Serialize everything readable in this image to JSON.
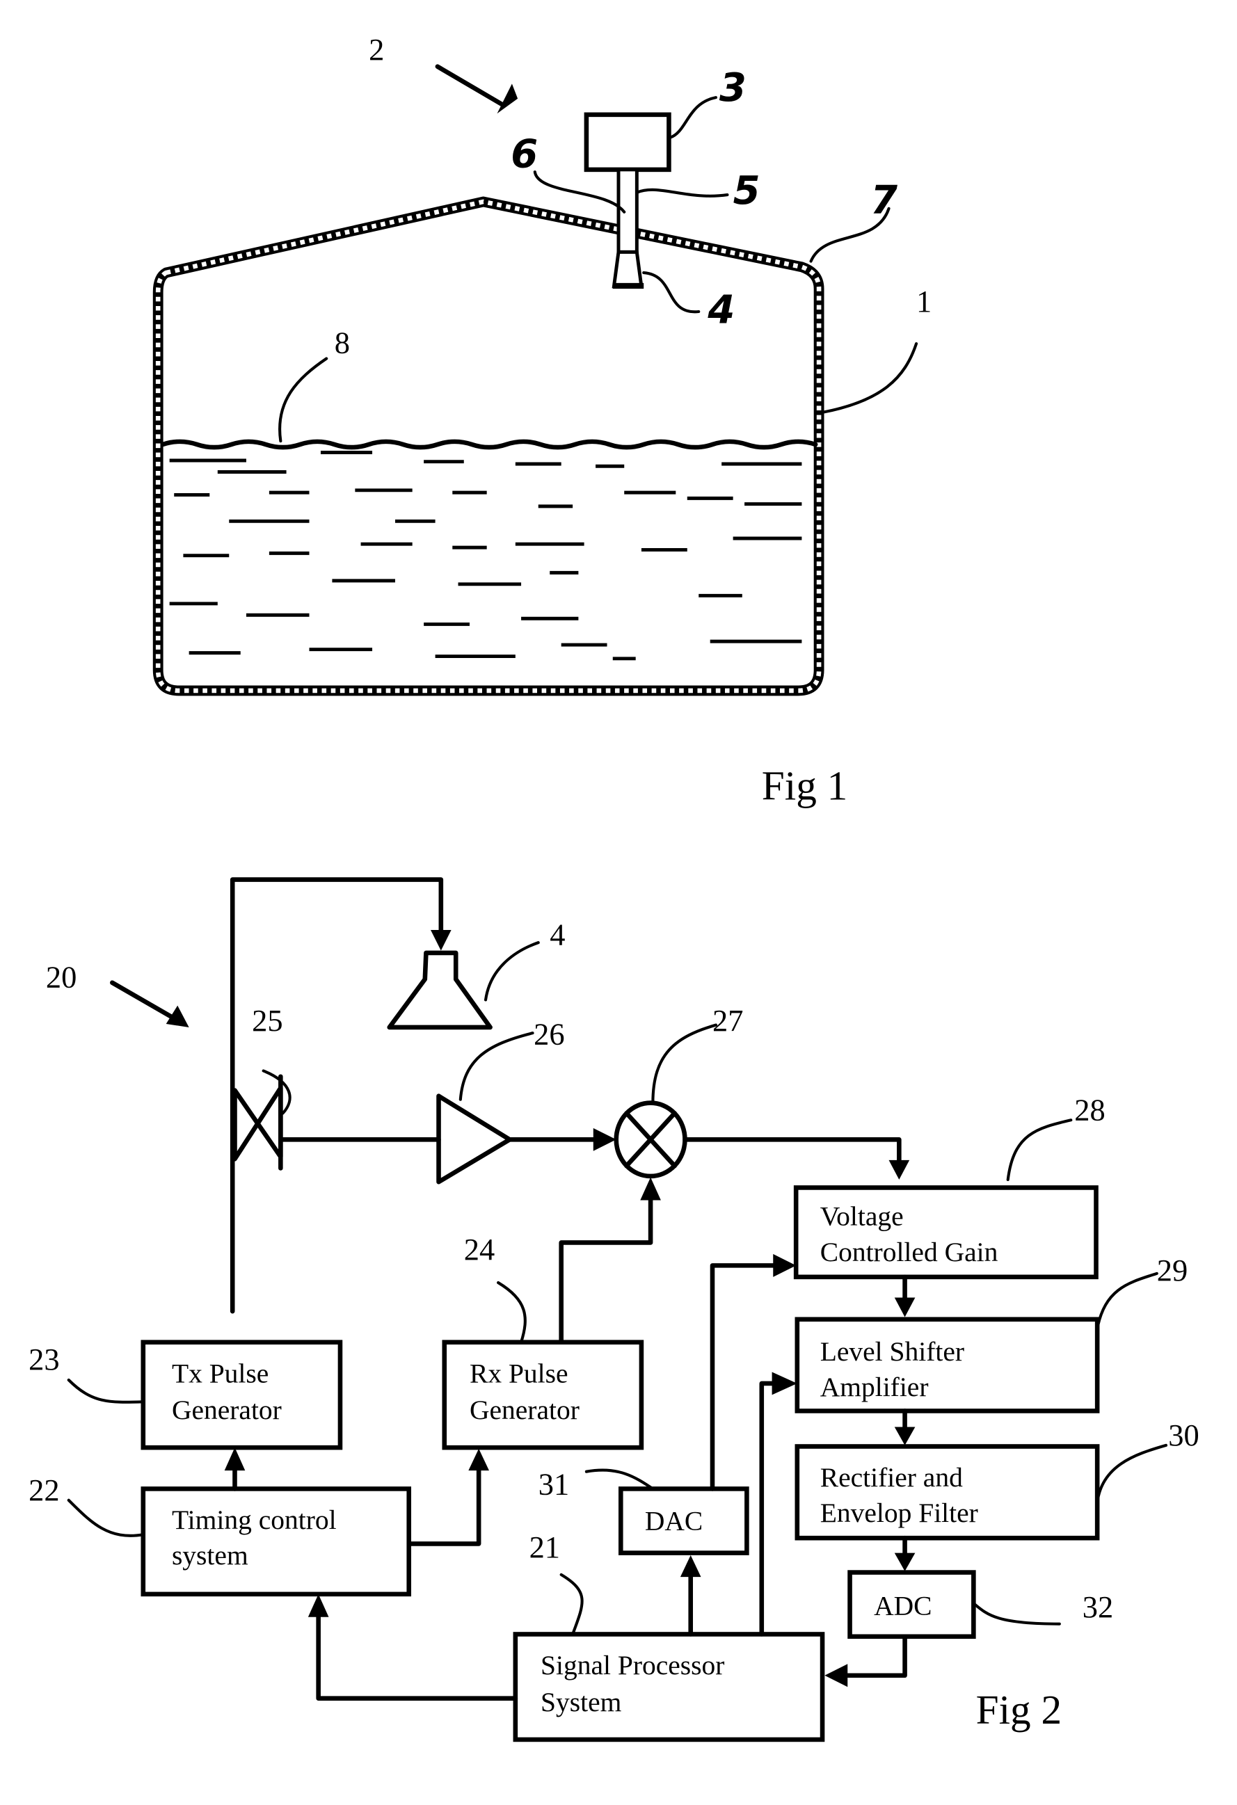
{
  "fig1": {
    "caption": "Fig 1",
    "refs": {
      "system": "2",
      "electronics_unit": "3",
      "antenna": "4",
      "waveguide": "5",
      "seal": "6",
      "roof": "7",
      "surface": "8",
      "tank": "1"
    }
  },
  "fig2": {
    "caption": "Fig 2",
    "refs": {
      "system": "20",
      "signal_processor": "21",
      "timing_control": "22",
      "tx_pulse_gen": "23",
      "rx_pulse_gen": "24",
      "coupler": "25",
      "amplifier": "26",
      "mixer": "27",
      "vcg": "28",
      "level_shifter": "29",
      "rectifier": "30",
      "dac": "31",
      "adc": "32",
      "antenna": "4"
    },
    "blocks": {
      "tx_pulse_gen": [
        "Tx Pulse",
        "Generator"
      ],
      "rx_pulse_gen": [
        "Rx Pulse",
        "Generator"
      ],
      "timing_control": [
        "Timing control",
        "system"
      ],
      "signal_processor": [
        "Signal Processor",
        "System"
      ],
      "vcg": [
        "Voltage",
        "Controlled Gain"
      ],
      "level_shifter": [
        "Level Shifter",
        "Amplifier"
      ],
      "rectifier": [
        "Rectifier and",
        "Envelop Filter"
      ],
      "dac": [
        "DAC"
      ],
      "adc": [
        "ADC"
      ]
    }
  }
}
